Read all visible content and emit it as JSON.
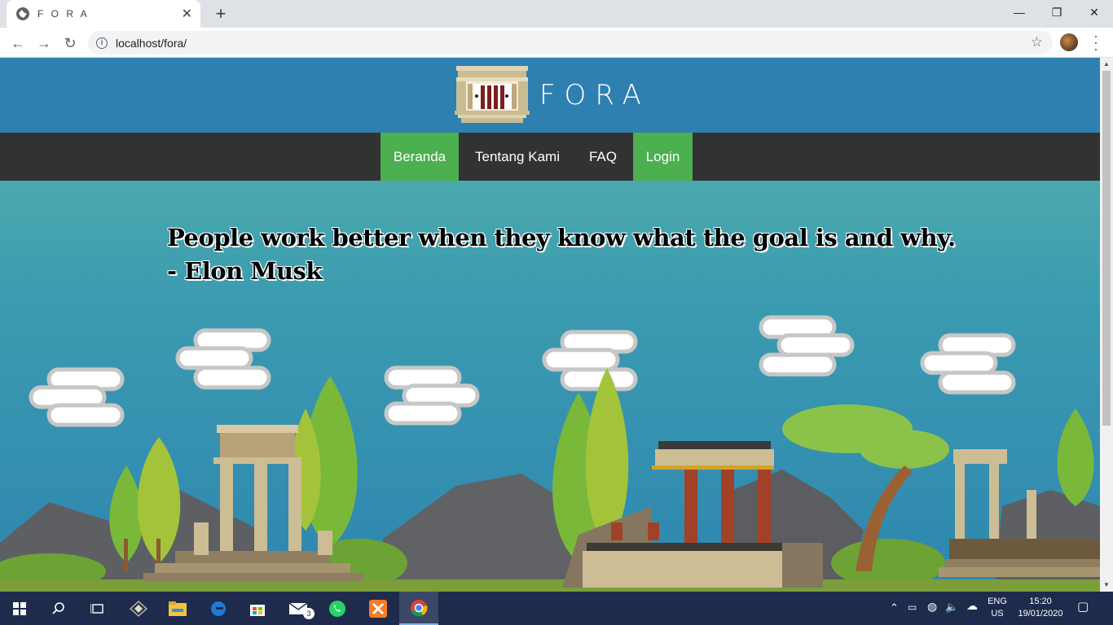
{
  "browser": {
    "tab_title": "F O R A",
    "tab_close": "✕",
    "new_tab": "+",
    "url": "localhost/fora/",
    "info": "i",
    "star": "☆",
    "back": "←",
    "forward": "→",
    "reload": "↻",
    "minimize": "—",
    "restore": "❐",
    "close": "✕"
  },
  "site": {
    "brand": "FORA",
    "nav": [
      {
        "label": "Beranda",
        "active": true
      },
      {
        "label": "Tentang Kami",
        "active": false
      },
      {
        "label": "FAQ",
        "active": false
      },
      {
        "label": "Login",
        "active": true
      }
    ],
    "quote_line1": "People work better when they know what the goal is and why.",
    "quote_line2": "- Elon Musk"
  },
  "colors": {
    "header": "#2e80b1",
    "navbar": "#323232",
    "nav_active": "#4caf50"
  },
  "taskbar": {
    "icons": [
      "windows-start-icon",
      "search-icon",
      "task-view-icon",
      "app-icon",
      "file-explorer-icon",
      "edge-icon",
      "store-icon",
      "mail-icon",
      "whatsapp-icon",
      "xampp-icon",
      "chrome-icon"
    ],
    "mail_badge": "3",
    "lang_line1": "ENG",
    "lang_line2": "US",
    "time": "15:20",
    "date": "19/01/2020"
  }
}
